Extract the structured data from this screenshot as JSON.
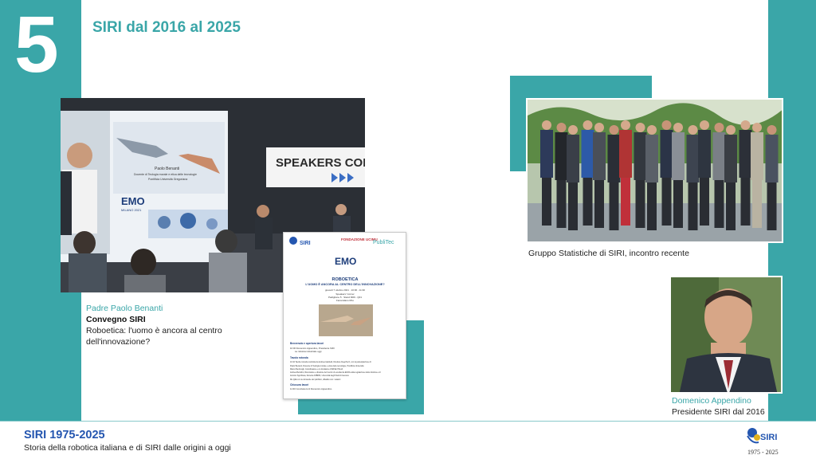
{
  "section_number": "5",
  "title": "SIRI dal 2016 al 2025",
  "colors": {
    "accent_teal": "#3aa6a8",
    "footer_blue": "#2456b0",
    "caption_teal": "#3aa6a8"
  },
  "conference_photo": {
    "screen_right": "SPEAKERS CORNER",
    "screen_left_name": "Paolo Benanti",
    "screen_left_role": "Docente di Teologia morale e etica delle tecnologie",
    "screen_left_univ": "Pontificia Università Gregoriana",
    "emo_logo": "EMO",
    "emo_sub": "MILANO 2021"
  },
  "flyer": {
    "logo_siri": "SIRI",
    "logo_fondazione": "FONDAZIONE UCIMU",
    "logo_publitec": "PubliTec",
    "emo": "EMO",
    "title": "ROBOETICA",
    "subtitle": "L'UOMO È ANCORA AL CENTRO DELL'INNOVAZIONE?",
    "date": "giovedì 7 ottobre 2021 · 10:00 - 11:30",
    "venue_1": "Speakers' Corner",
    "venue_2": "Padiglione 5 · Stand M09 - Q01",
    "venue_3": "Fieramilano Rho",
    "section_1": "Benvenuto e apertura lavori",
    "line_1": "10:00 Domenico Appendino, Presidente SIRI",
    "line_2": "La robotica industriale oggi",
    "section_2": "Tavola rotonda",
    "line_3": "10:10 Tavola rotonda condotta da Andrea Gabrielli, Direttore DeepTech, con la partecipazione di:",
    "line_4": "Paolo Benanti, Docente di Teologia morale e etica delle tecnologie, Pontificia Università",
    "line_5": "Marco Bentivogli, Coordinatore e co-fondatore di BASE ITALIA",
    "line_6": "Andrea Bertolini, Ricercatore e direttore del Centro di eccellenza EURA sulla regolazione della robotica e AI",
    "line_7": "Antonio Sgorbissa, Docente DIBRIS, Università degli Studi di Genova",
    "line_8": "Ms Q&A con le domande del pubblico, dibattito con i relatori",
    "section_3": "Chiusura lavori",
    "line_9": "11:30 Conclusioni di Domenico Appendino"
  },
  "captions": {
    "conference": {
      "name": "Padre Paolo Benanti",
      "event": "Convegno SIRI",
      "topic_1": "Roboetica: l'uomo è ancora al centro",
      "topic_2": "dell'innovazione?"
    },
    "group": {
      "text": "Gruppo Statistiche di SIRI, incontro recente"
    },
    "president": {
      "name": "Domenico Appendino",
      "role": "Presidente SIRI dal 2016"
    }
  },
  "footer": {
    "title": "SIRI 1975-2025",
    "subtitle": "Storia della robotica italiana e di SIRI  dalle origini a oggi",
    "logo_text": "SIRI",
    "logo_years": "1975 - 2025"
  }
}
